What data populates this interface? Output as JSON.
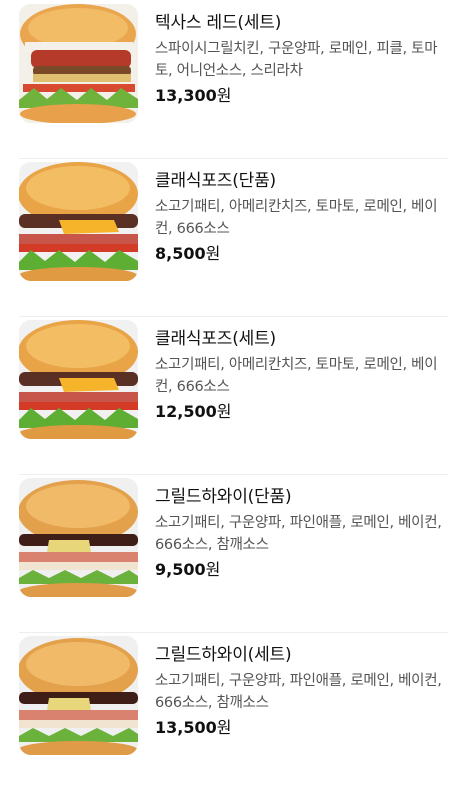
{
  "menu_items": [
    {
      "name": "텍사스 레드(세트)",
      "description": "스파이시그릴치킨, 구운양파, 로메인, 피클, 토마토, 어니언소스, 스리라차",
      "price": "13,300",
      "currency": "원",
      "image": "spicy-chicken-burger"
    },
    {
      "name": "클래식포즈(단품)",
      "description": "소고기패티, 아메리칸치즈, 토마토, 로메인, 베이컨, 666소스",
      "price": "8,500",
      "currency": "원",
      "image": "classic-cheese-burger"
    },
    {
      "name": "클래식포즈(세트)",
      "description": "소고기패티, 아메리칸치즈, 토마토, 로메인, 베이컨, 666소스",
      "price": "12,500",
      "currency": "원",
      "image": "classic-cheese-burger"
    },
    {
      "name": "그릴드하와이(단품)",
      "description": "소고기패티, 구운양파, 파인애플, 로메인, 베이컨, 666소스, 참깨소스",
      "price": "9,500",
      "currency": "원",
      "image": "hawaiian-burger"
    },
    {
      "name": "그릴드하와이(세트)",
      "description": "소고기패티, 구운양파, 파인애플, 로메인, 베이컨, 666소스, 참깨소스",
      "price": "13,500",
      "currency": "원",
      "image": "hawaiian-burger"
    }
  ]
}
